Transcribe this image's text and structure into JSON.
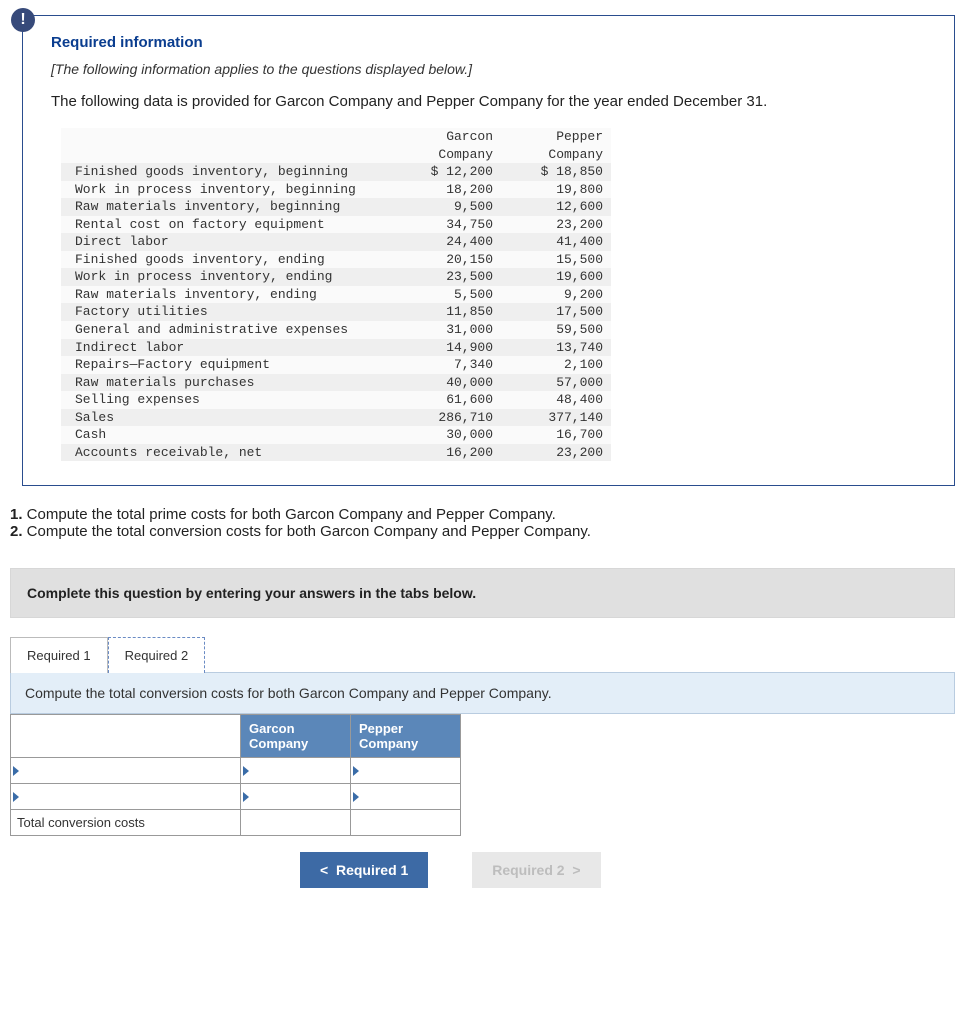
{
  "alert_glyph": "!",
  "info": {
    "title": "Required information",
    "note": "[The following information applies to the questions displayed below.]",
    "intro": "The following data is provided for Garcon Company and Pepper Company for the year ended December 31."
  },
  "data_headers": {
    "col1": "Garcon",
    "col1b": "Company",
    "col2": "Pepper",
    "col2b": "Company"
  },
  "data_rows": [
    {
      "label": "Finished goods inventory, beginning",
      "garcon": "$ 12,200",
      "pepper": "$ 18,850"
    },
    {
      "label": "Work in process inventory, beginning",
      "garcon": "18,200",
      "pepper": "19,800"
    },
    {
      "label": "Raw materials inventory, beginning",
      "garcon": "9,500",
      "pepper": "12,600"
    },
    {
      "label": "Rental cost on factory equipment",
      "garcon": "34,750",
      "pepper": "23,200"
    },
    {
      "label": "Direct labor",
      "garcon": "24,400",
      "pepper": "41,400"
    },
    {
      "label": "Finished goods inventory, ending",
      "garcon": "20,150",
      "pepper": "15,500"
    },
    {
      "label": "Work in process inventory, ending",
      "garcon": "23,500",
      "pepper": "19,600"
    },
    {
      "label": "Raw materials inventory, ending",
      "garcon": "5,500",
      "pepper": "9,200"
    },
    {
      "label": "Factory utilities",
      "garcon": "11,850",
      "pepper": "17,500"
    },
    {
      "label": "General and administrative expenses",
      "garcon": "31,000",
      "pepper": "59,500"
    },
    {
      "label": "Indirect labor",
      "garcon": "14,900",
      "pepper": "13,740"
    },
    {
      "label": "Repairs—Factory equipment",
      "garcon": "7,340",
      "pepper": "2,100"
    },
    {
      "label": "Raw materials purchases",
      "garcon": "40,000",
      "pepper": "57,000"
    },
    {
      "label": "Selling expenses",
      "garcon": "61,600",
      "pepper": "48,400"
    },
    {
      "label": "Sales",
      "garcon": "286,710",
      "pepper": "377,140"
    },
    {
      "label": "Cash",
      "garcon": "30,000",
      "pepper": "16,700"
    },
    {
      "label": "Accounts receivable, net",
      "garcon": "16,200",
      "pepper": "23,200"
    }
  ],
  "questions": {
    "q1_num": "1.",
    "q1_text": " Compute the total prime costs for both Garcon Company and Pepper Company.",
    "q2_num": "2.",
    "q2_text": " Compute the total conversion costs for both Garcon Company and Pepper Company."
  },
  "answer": {
    "instruction": "Complete this question by entering your answers in the tabs below.",
    "tabs": {
      "req1": "Required 1",
      "req2": "Required 2"
    },
    "tab_desc": "Compute the total conversion costs for both Garcon Company and Pepper Company.",
    "table": {
      "hdr_garcon": "Garcon Company",
      "hdr_pepper": "Pepper Company",
      "total_label": "Total conversion costs"
    },
    "nav": {
      "prev": "Required 1",
      "next": "Required 2"
    }
  }
}
